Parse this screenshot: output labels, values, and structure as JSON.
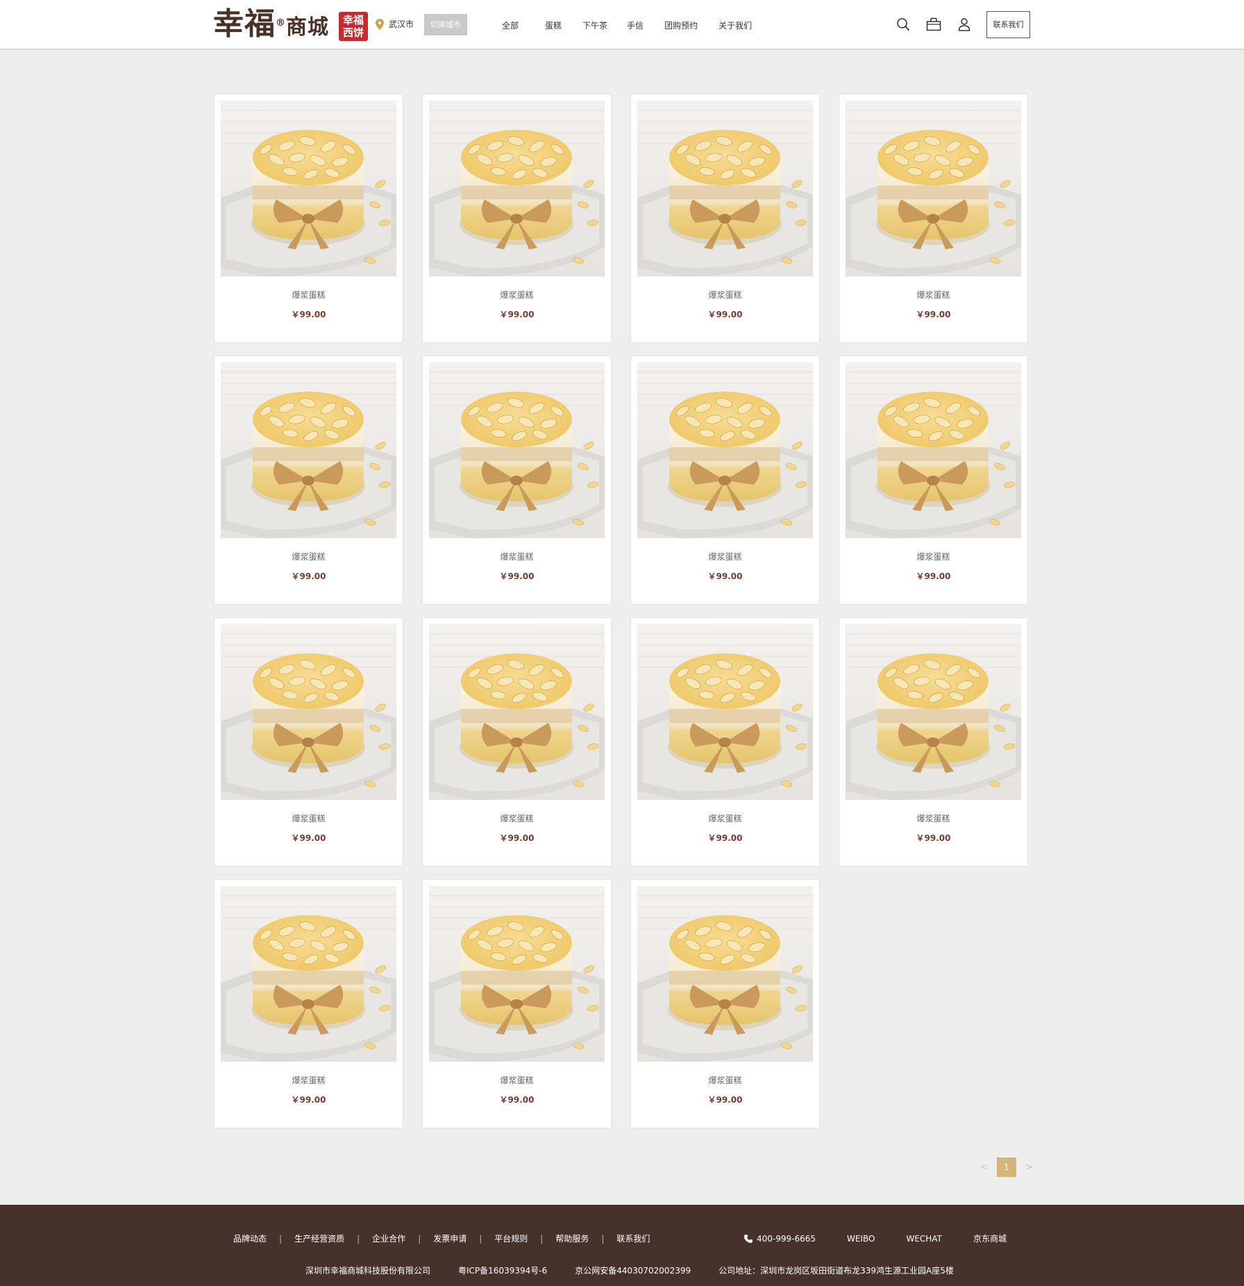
{
  "header": {
    "logo_main": "幸福",
    "logo_reg": "®",
    "logo_sub": "商城",
    "logo_seal": "幸福西饼",
    "city": "武汉市",
    "switch_city_label": "切换城市",
    "nav": [
      "全部",
      "蛋糕",
      "下午茶",
      "手信",
      "团购预约",
      "关于我们"
    ],
    "icons": [
      "search-icon",
      "bag-icon",
      "user-icon"
    ],
    "contact_label": "联系我们"
  },
  "products": [
    {
      "name": "爆浆蛋糕",
      "price": "￥99.00"
    },
    {
      "name": "爆浆蛋糕",
      "price": "￥99.00"
    },
    {
      "name": "爆浆蛋糕",
      "price": "￥99.00"
    },
    {
      "name": "爆浆蛋糕",
      "price": "￥99.00"
    },
    {
      "name": "爆浆蛋糕",
      "price": "￥99.00"
    },
    {
      "name": "爆浆蛋糕",
      "price": "￥99.00"
    },
    {
      "name": "爆浆蛋糕",
      "price": "￥99.00"
    },
    {
      "name": "爆浆蛋糕",
      "price": "￥99.00"
    },
    {
      "name": "爆浆蛋糕",
      "price": "￥99.00"
    },
    {
      "name": "爆浆蛋糕",
      "price": "￥99.00"
    },
    {
      "name": "爆浆蛋糕",
      "price": "￥99.00"
    },
    {
      "name": "爆浆蛋糕",
      "price": "￥99.00"
    },
    {
      "name": "爆浆蛋糕",
      "price": "￥99.00"
    },
    {
      "name": "爆浆蛋糕",
      "price": "￥99.00"
    },
    {
      "name": "爆浆蛋糕",
      "price": "￥99.00"
    }
  ],
  "pagination": {
    "prev": "<",
    "current": "1",
    "next": ">"
  },
  "footer": {
    "links": [
      "品牌动态",
      "生产经营资质",
      "企业合作",
      "发票申请",
      "平台规则",
      "帮助服务",
      "联系我们"
    ],
    "phone": "400-999-6665",
    "social": [
      "WEIBO",
      "WECHAT",
      "京东商城"
    ],
    "company": "深圳市幸福商城科技股份有限公司",
    "icp": "粤ICP备16039394号-6",
    "police": "京公网安备44030702002399",
    "address": "公司地址：深圳市龙岗区坂田街道布龙339鸿生源工业园A座5楼"
  },
  "colors": {
    "brand_brown": "#46322a",
    "seal_red": "#c9282d",
    "price": "#7a3a2e",
    "page_active": "#d4b577"
  }
}
